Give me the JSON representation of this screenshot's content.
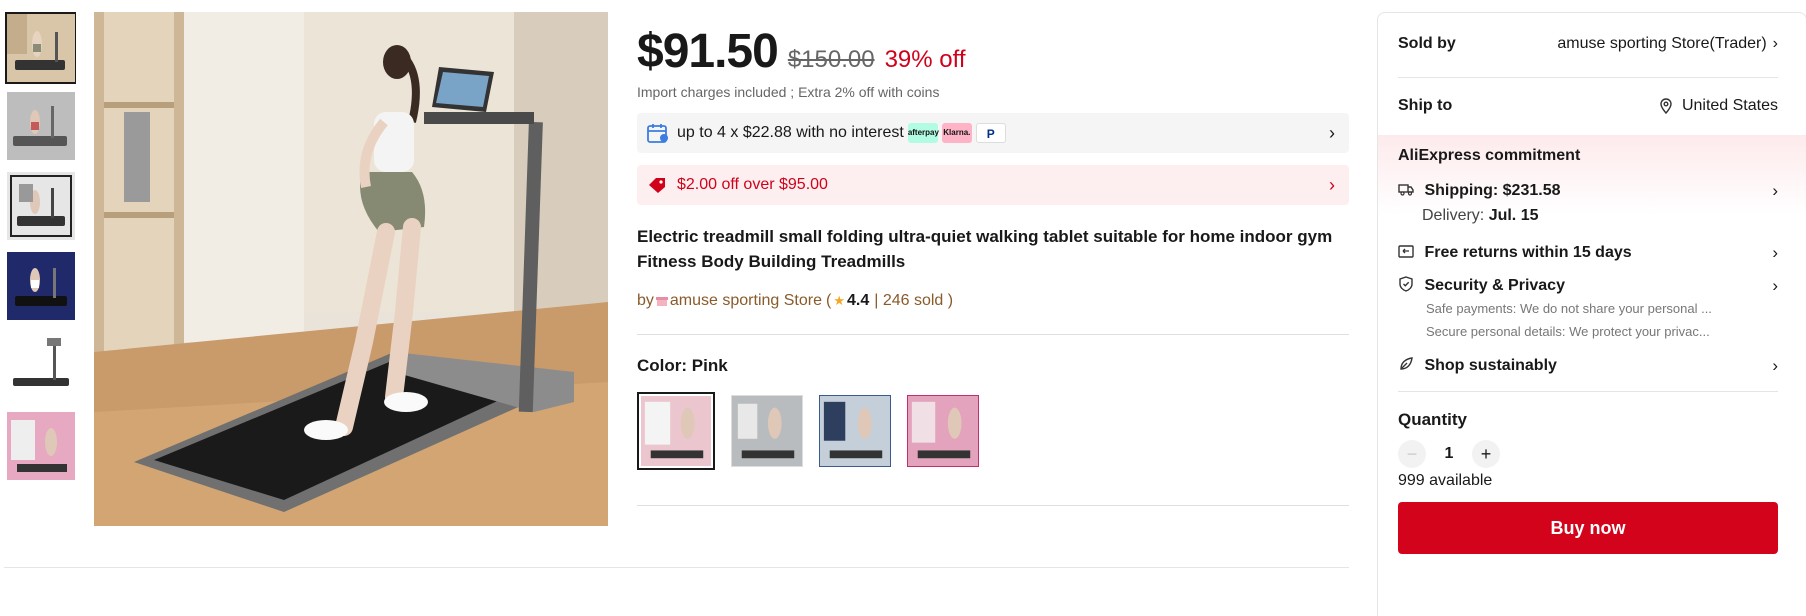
{
  "price": {
    "current": "$91.50",
    "original": "$150.00",
    "discount": "39% off",
    "import_note": "Import charges included ; Extra 2% off with coins"
  },
  "installment": {
    "text": "up to 4 x $22.88 with no interest",
    "badges": [
      "afterpay",
      "Klarna.",
      "P"
    ]
  },
  "coupon": {
    "text": "$2.00 off over $95.00"
  },
  "product": {
    "title": "Electric treadmill small folding ultra-quiet walking tablet suitable for home indoor gym Fitness Body Building Treadmills",
    "by_prefix": "by",
    "store": "amuse sporting Store",
    "rating_open": "(",
    "rating": "4.4",
    "sold": "| 246 sold )"
  },
  "color": {
    "label": "Color:",
    "value": "Pink"
  },
  "seller_panel": {
    "sold_by_label": "Sold by",
    "sold_by_value": "amuse sporting Store(Trader)",
    "ship_to_label": "Ship to",
    "ship_to_value": "United States",
    "commitment_title": "AliExpress commitment",
    "shipping": "Shipping: $231.58",
    "delivery_label": "Delivery:",
    "delivery_value": "Jul. 15",
    "returns": "Free returns within 15 days",
    "security": "Security & Privacy",
    "security_sub1": "Safe payments: We do not share your personal ...",
    "security_sub2": "Secure personal details: We protect your privac...",
    "sustain": "Shop sustainably",
    "quantity_label": "Quantity",
    "quantity_value": "1",
    "available": "999 available",
    "buy_now": "Buy now"
  },
  "colors": {
    "accent_red": "#d3031c",
    "price_red": "#d0021b",
    "store_brown": "#8a5a2b"
  },
  "icons": [
    "calendar-icon",
    "tag-icon",
    "location-pin-icon",
    "truck-icon",
    "return-icon",
    "shield-icon",
    "leaf-icon",
    "chevron-right-icon",
    "star-icon"
  ]
}
